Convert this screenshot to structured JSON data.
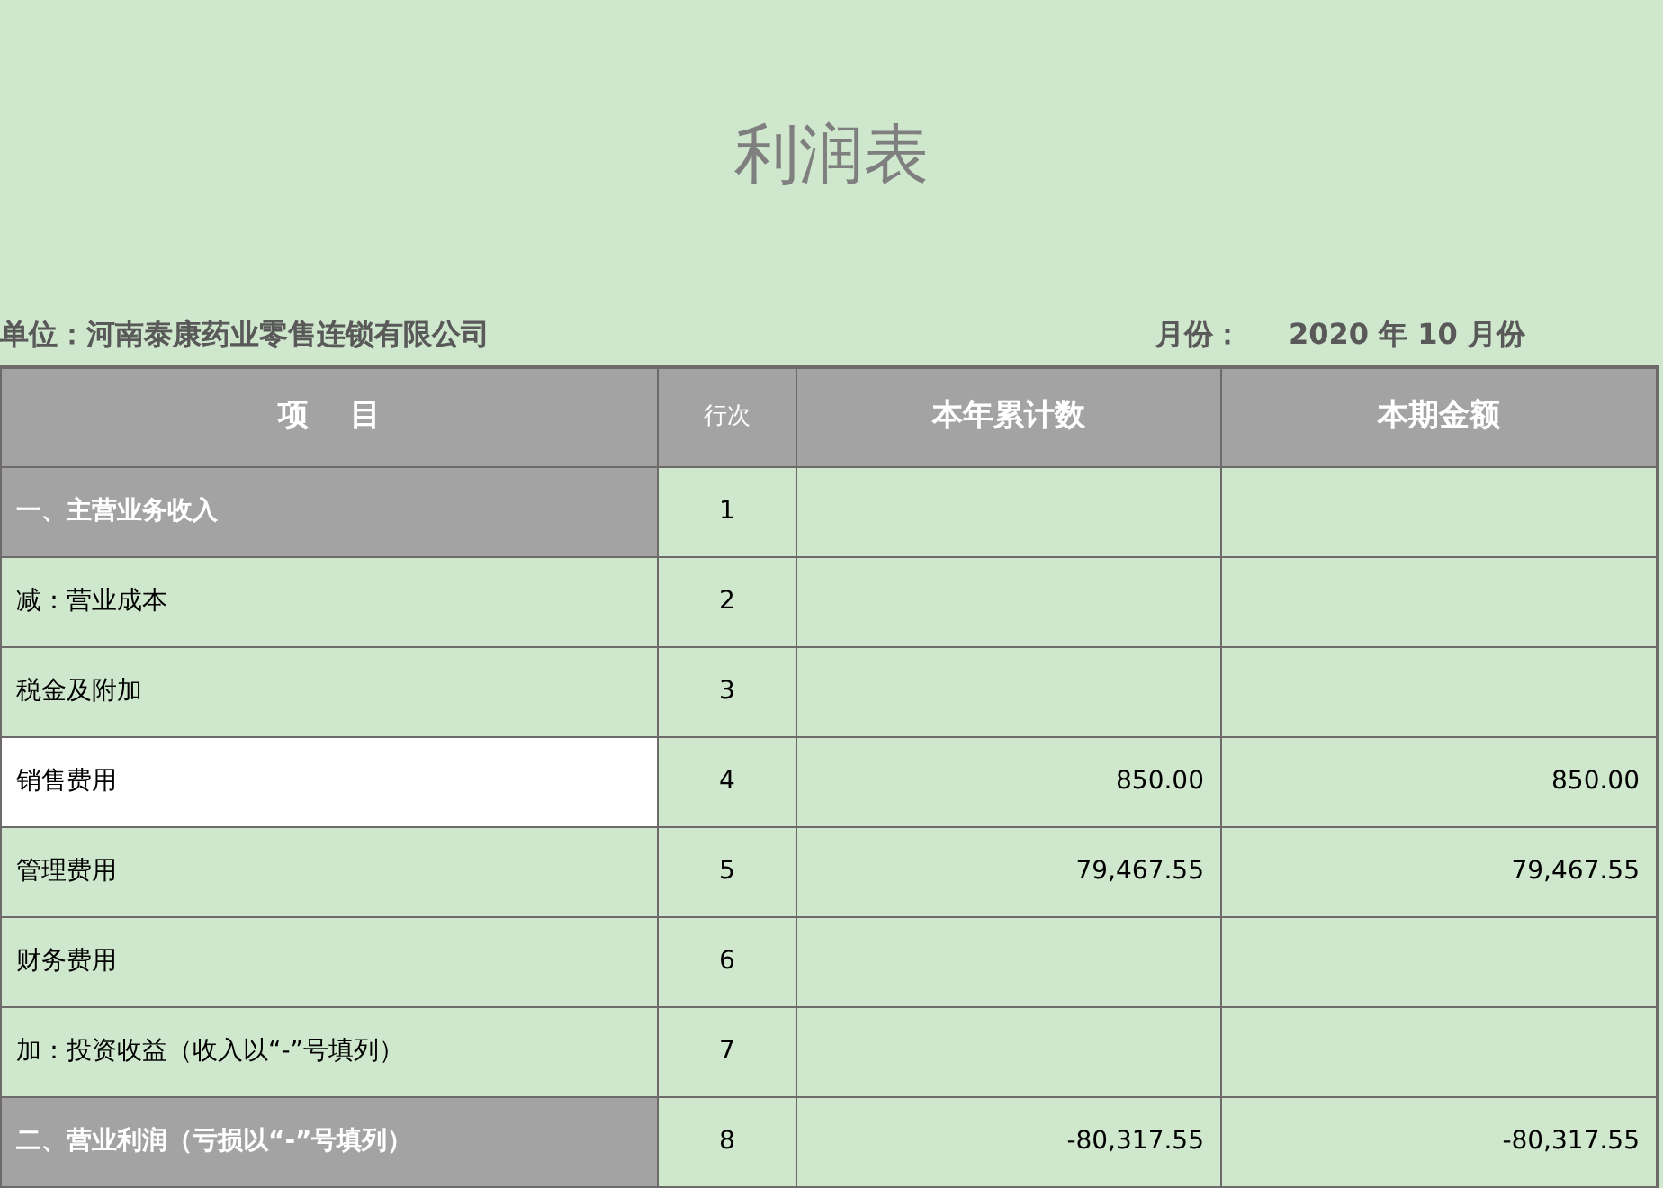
{
  "title": "利润表",
  "unit": {
    "label": "单位：",
    "value": "河南泰康药业零售连锁有限公司"
  },
  "period": {
    "label": "月份：",
    "value": "2020 年 10 月份"
  },
  "table": {
    "columns": [
      "项　 目",
      "行次",
      "本年累计数",
      "本期金额"
    ],
    "rows": [
      {
        "kind": "section",
        "selected": false,
        "item": "一、主营业务收入",
        "line": "1"
      },
      {
        "kind": "item",
        "selected": false,
        "item": "减：营业成本",
        "line": "2"
      },
      {
        "kind": "item",
        "selected": false,
        "item": "税金及附加",
        "line": "3"
      },
      {
        "kind": "item",
        "selected": true,
        "item": "销售费用",
        "line": "4",
        "ytd": "850.00",
        "current": "850.00"
      },
      {
        "kind": "item",
        "selected": false,
        "item": "管理费用",
        "line": "5",
        "ytd": "79,467.55",
        "current": "79,467.55"
      },
      {
        "kind": "item",
        "selected": false,
        "item": "财务费用",
        "line": "6"
      },
      {
        "kind": "item",
        "selected": false,
        "item": "加：投资收益（收入以“-”号填列）",
        "line": "7"
      },
      {
        "kind": "section",
        "selected": false,
        "item": "二、营业利润（亏损以“-”号填列）",
        "line": "8",
        "ytd": "-80,317.55",
        "current": "-80,317.55"
      }
    ]
  }
}
